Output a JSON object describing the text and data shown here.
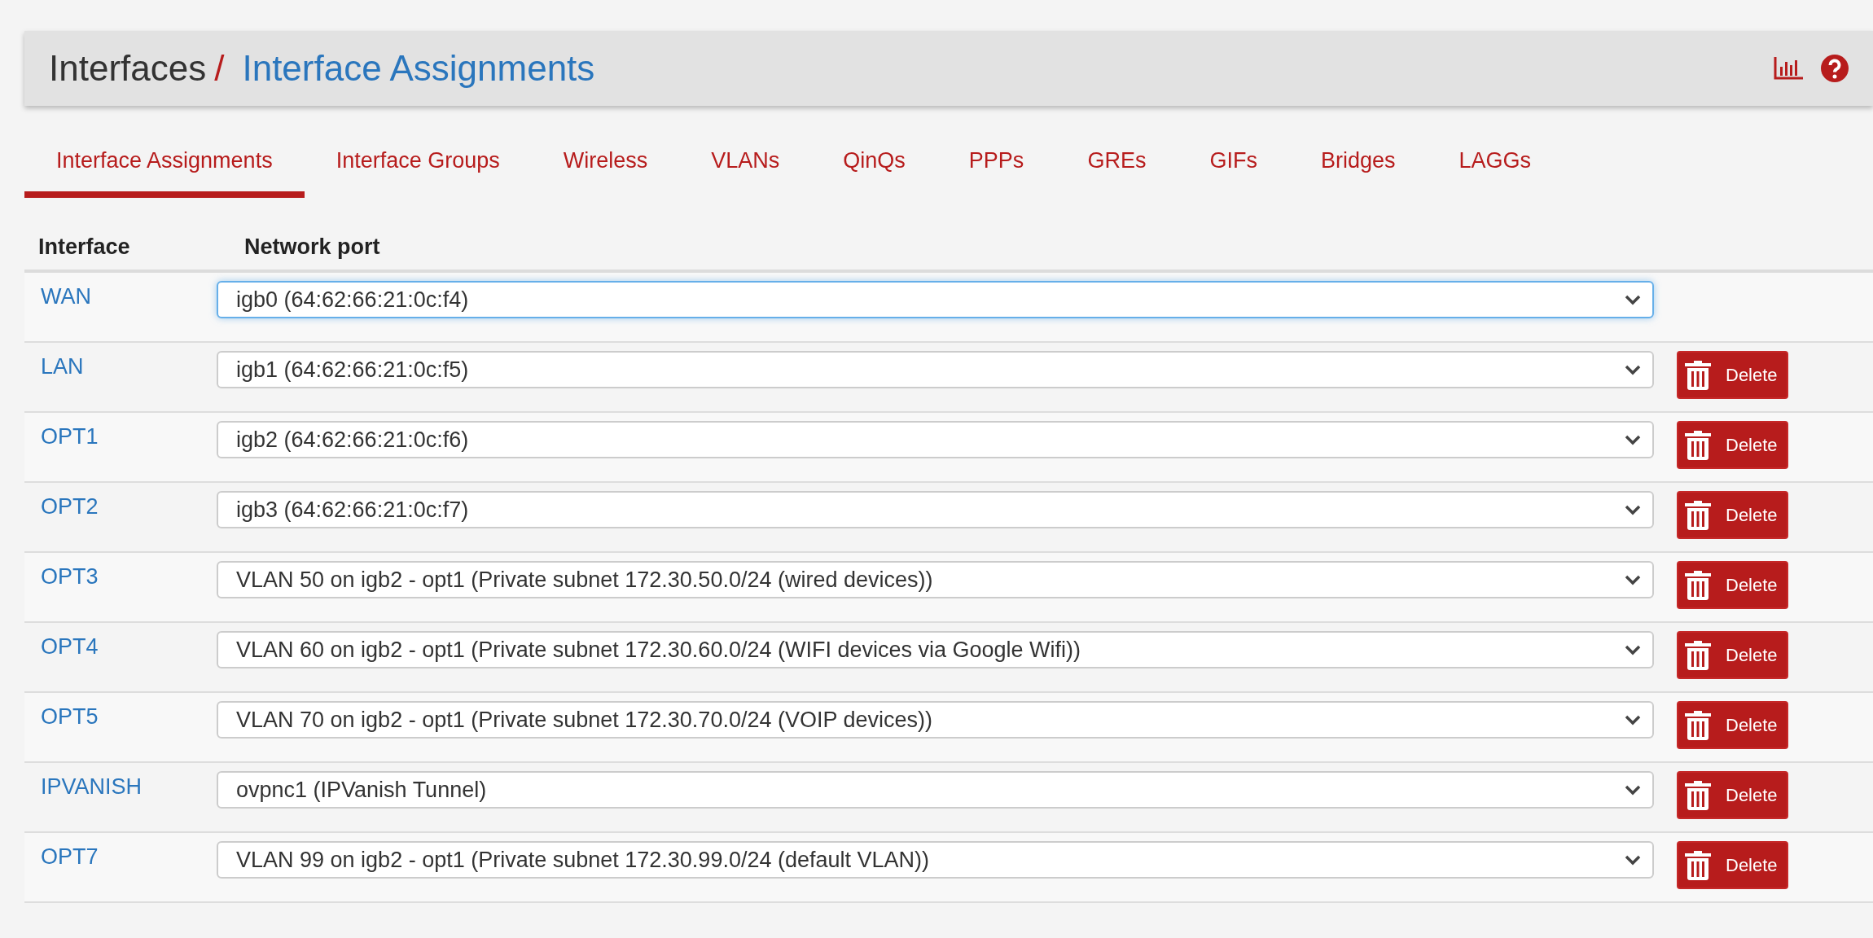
{
  "breadcrumb": {
    "parent": "Interfaces",
    "separator": "/",
    "current": "Interface Assignments"
  },
  "tabs": [
    {
      "label": "Interface Assignments",
      "selected": true
    },
    {
      "label": "Interface Groups",
      "selected": false
    },
    {
      "label": "Wireless",
      "selected": false
    },
    {
      "label": "VLANs",
      "selected": false
    },
    {
      "label": "QinQs",
      "selected": false
    },
    {
      "label": "PPPs",
      "selected": false
    },
    {
      "label": "GREs",
      "selected": false
    },
    {
      "label": "GIFs",
      "selected": false
    },
    {
      "label": "Bridges",
      "selected": false
    },
    {
      "label": "LAGGs",
      "selected": false
    }
  ],
  "table": {
    "columns": [
      "Interface",
      "Network port"
    ],
    "rows": [
      {
        "interface": "WAN",
        "port": "igb0 (64:62:66:21:0c:f4)",
        "focused": true,
        "delete": null
      },
      {
        "interface": "LAN",
        "port": "igb1 (64:62:66:21:0c:f5)",
        "focused": false,
        "delete": "Delete"
      },
      {
        "interface": "OPT1",
        "port": "igb2 (64:62:66:21:0c:f6)",
        "focused": false,
        "delete": "Delete"
      },
      {
        "interface": "OPT2",
        "port": "igb3 (64:62:66:21:0c:f7)",
        "focused": false,
        "delete": "Delete"
      },
      {
        "interface": "OPT3",
        "port": "VLAN 50 on igb2 - opt1 (Private subnet 172.30.50.0/24 (wired devices))",
        "focused": false,
        "delete": "Delete"
      },
      {
        "interface": "OPT4",
        "port": "VLAN 60 on igb2 - opt1 (Private subnet 172.30.60.0/24 (WIFI devices via Google Wifi))",
        "focused": false,
        "delete": "Delete"
      },
      {
        "interface": "OPT5",
        "port": "VLAN 70 on igb2 - opt1 (Private subnet 172.30.70.0/24 (VOIP devices))",
        "focused": false,
        "delete": "Delete"
      },
      {
        "interface": "IPVANISH",
        "port": "ovpnc1 (IPVanish Tunnel)",
        "focused": false,
        "delete": "Delete"
      },
      {
        "interface": "OPT7",
        "port": "VLAN 99 on igb2 - opt1 (Private subnet 172.30.99.0/24 (default VLAN))",
        "focused": false,
        "delete": "Delete"
      }
    ]
  }
}
